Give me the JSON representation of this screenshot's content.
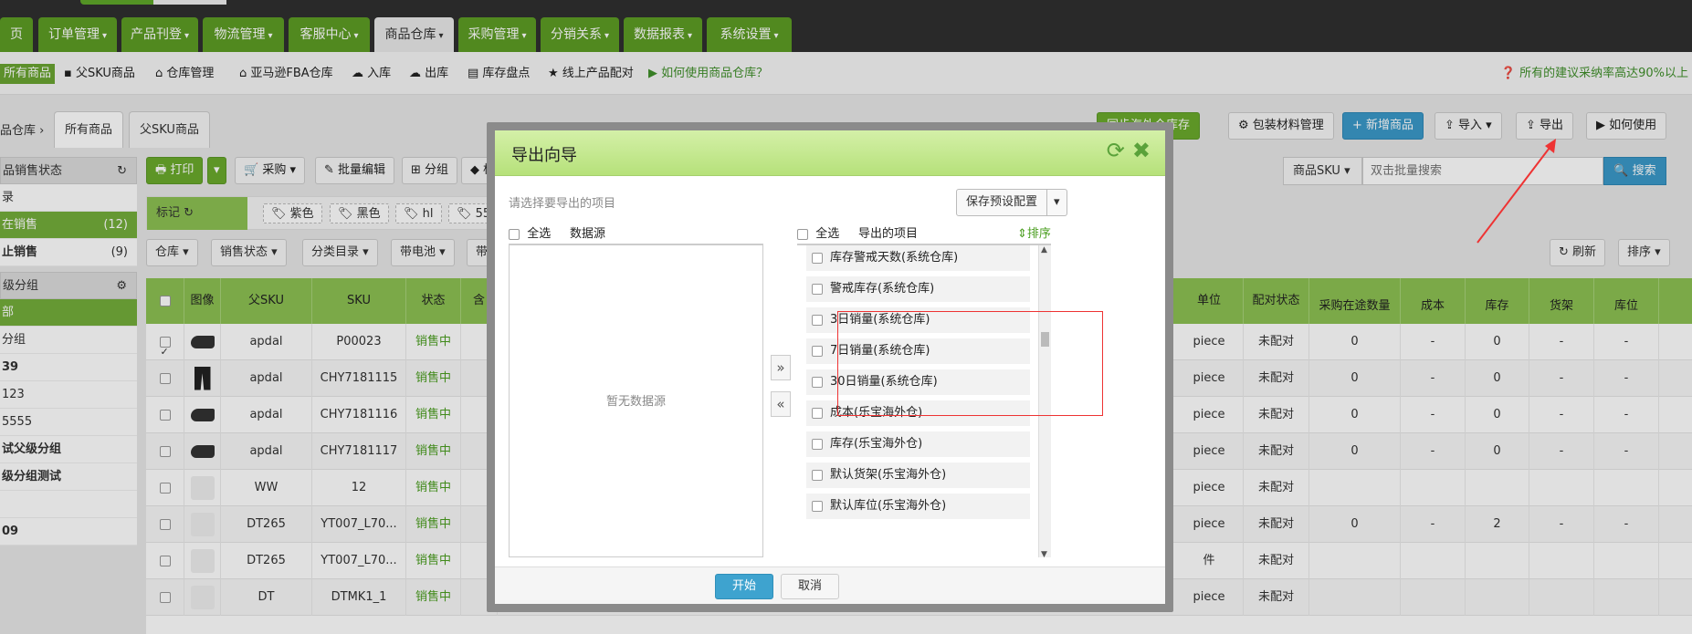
{
  "nav": {
    "tabs": [
      {
        "label": "页",
        "caret": false
      },
      {
        "label": "订单管理",
        "caret": true
      },
      {
        "label": "产品刊登",
        "caret": true
      },
      {
        "label": "物流管理",
        "caret": true
      },
      {
        "label": "客服中心",
        "caret": true
      },
      {
        "label": "商品仓库",
        "caret": true,
        "active": true
      },
      {
        "label": "采购管理",
        "caret": true
      },
      {
        "label": "分销关系",
        "caret": true
      },
      {
        "label": "数据报表",
        "caret": true
      },
      {
        "label": "系统设置",
        "caret": true
      }
    ]
  },
  "subnav": {
    "items": [
      "所有商品",
      "父SKU商品",
      "仓库管理",
      "亚马逊FBA仓库",
      "入库",
      "出库",
      "库存盘点",
      "线上产品配对",
      "如何使用商品仓库？"
    ],
    "right_text": "所有的建议采纳率高达90%以上"
  },
  "breadcrumb": {
    "root": "品仓库",
    "sep": "›"
  },
  "content_tabs": [
    "所有商品",
    "父SKU商品"
  ],
  "top_buttons": [
    "同步海外仓库存",
    "包装材料管理",
    "新增商品",
    "导入",
    "导出",
    "如何使用"
  ],
  "sidebar": {
    "sales_status_title": "品销售状态",
    "rows1": [
      {
        "label": "",
        "count": ""
      },
      {
        "label": "在销售",
        "count": "(12)",
        "active": true
      },
      {
        "label": "止销售",
        "count": "(9)"
      }
    ],
    "group_title": "级分组",
    "rows2": [
      "部",
      "分组",
      "39",
      "123",
      "5555",
      "试父级分组",
      "级分组测试",
      "",
      "09"
    ]
  },
  "toolbar": {
    "print": "打印",
    "purchase": "采购",
    "bulk_edit": "批量编辑",
    "group": "分组",
    "tag": "标"
  },
  "search": {
    "type": "商品SKU",
    "placeholder": "双击批量搜索",
    "button": "搜索"
  },
  "tagbar": {
    "mark": "标记",
    "tags": [
      "紫色",
      "黑色",
      "hl",
      "5555"
    ]
  },
  "filters": [
    "仓库",
    "销售状态",
    "分类目录",
    "带电池",
    "带"
  ],
  "right_filters": [
    "刷新",
    "排序"
  ],
  "table": {
    "headers_left": [
      "",
      "图像",
      "父SKU",
      "SKU",
      "状态",
      "含"
    ],
    "headers_right": [
      "单位",
      "配对状态",
      "采购在途数量",
      "成本",
      "库存",
      "货架",
      "库位"
    ],
    "rows": [
      {
        "checked": true,
        "img": "shoe",
        "parent": "apdal",
        "sku": "P00023",
        "status": "销售中",
        "unit": "piece",
        "pair": "未配对",
        "transit": "0",
        "cost": "-",
        "stock": "0",
        "shelf": "-",
        "loc": "-"
      },
      {
        "checked": false,
        "img": "pants",
        "parent": "apdal",
        "sku": "CHY7181115",
        "status": "销售中",
        "unit": "piece",
        "pair": "未配对",
        "transit": "0",
        "cost": "-",
        "stock": "0",
        "shelf": "-",
        "loc": "-"
      },
      {
        "checked": false,
        "img": "shoe",
        "parent": "apdal",
        "sku": "CHY7181116",
        "status": "销售中",
        "unit": "piece",
        "pair": "未配对",
        "transit": "0",
        "cost": "-",
        "stock": "0",
        "shelf": "-",
        "loc": "-"
      },
      {
        "checked": false,
        "img": "shoe",
        "parent": "apdal",
        "sku": "CHY7181117",
        "status": "销售中",
        "unit": "piece",
        "pair": "未配对",
        "transit": "0",
        "cost": "-",
        "stock": "0",
        "shelf": "-",
        "loc": "-"
      },
      {
        "checked": false,
        "img": "ph",
        "parent": "WW",
        "sku": "12",
        "status": "销售中",
        "unit": "piece",
        "pair": "未配对",
        "transit": "",
        "cost": "",
        "stock": "",
        "shelf": "",
        "loc": ""
      },
      {
        "checked": false,
        "img": "ph",
        "parent": "DT265",
        "sku": "YT007_L70...",
        "status": "销售中",
        "unit": "piece",
        "pair": "未配对",
        "transit": "0",
        "cost": "-",
        "stock": "2",
        "shelf": "-",
        "loc": "-"
      },
      {
        "checked": false,
        "img": "ph",
        "parent": "DT265",
        "sku": "YT007_L70...",
        "status": "销售中",
        "unit": "件",
        "pair": "未配对",
        "transit": "",
        "cost": "",
        "stock": "",
        "shelf": "",
        "loc": ""
      },
      {
        "checked": false,
        "img": "ph",
        "parent": "DT",
        "sku": "DTMK1_1",
        "status": "销售中",
        "unit": "piece",
        "pair": "未配对",
        "transit": "",
        "cost": "",
        "stock": "",
        "shelf": "",
        "loc": ""
      }
    ]
  },
  "modal": {
    "title": "导出向导",
    "subtitle": "请选择要导出的项目",
    "save_config": "保存预设配置",
    "left_select_all": "全选",
    "left_title": "数据源",
    "left_empty": "暂无数据源",
    "right_select_all": "全选",
    "right_title": "导出的项目",
    "sort": "排序",
    "items": [
      "库存警戒天数(系统仓库)",
      "警戒库存(系统仓库)",
      "3日销量(系统仓库)",
      "7日销量(系统仓库)",
      "30日销量(系统仓库)",
      "成本(乐宝海外仓)",
      "库存(乐宝海外仓)",
      "默认货架(乐宝海外仓)",
      "默认库位(乐宝海外仓)"
    ],
    "start": "开始",
    "cancel": "取消"
  },
  "colors": {
    "brand_green": "#5d9c24",
    "accent_blue": "#3b99c9",
    "annotation_red": "#e33333"
  }
}
